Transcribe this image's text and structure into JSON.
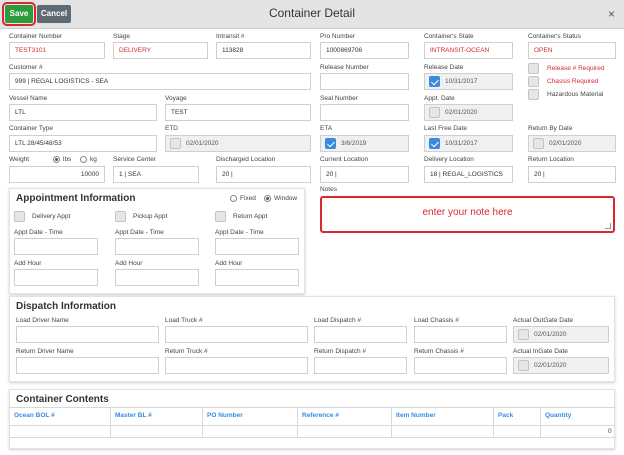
{
  "toolbar": {
    "save_label": "Save",
    "cancel_label": "Cancel",
    "title": "Container Detail",
    "close_label": "×"
  },
  "fields": {
    "container_number": {
      "label": "Container Number",
      "value": "TEST3101"
    },
    "stage": {
      "label": "Stage",
      "value": "DELIVERY"
    },
    "intransit": {
      "label": "Intransit #",
      "value": "113828"
    },
    "pro_number": {
      "label": "Pro Number",
      "value": "1000869706"
    },
    "container_state": {
      "label": "Container's State",
      "value": "INTRANSIT-OCEAN"
    },
    "container_status": {
      "label": "Container's Status",
      "value": "OPEN"
    },
    "customer": {
      "label": "Customer #",
      "value": "999 | REGAL LOGISTICS - SEA"
    },
    "release_number": {
      "label": "Release Number",
      "value": ""
    },
    "release_date": {
      "label": "Release Date",
      "value": "10/31/2017"
    },
    "vessel_name": {
      "label": "Vessel Name",
      "value": "LTL"
    },
    "voyage": {
      "label": "Voyage",
      "value": "TEST"
    },
    "seal_number": {
      "label": "Seal Number",
      "value": ""
    },
    "appt_date": {
      "label": "Appt. Date",
      "value": "02/01/2020"
    },
    "container_type": {
      "label": "Container Type",
      "value": "LTL 28/45/48/53"
    },
    "etd": {
      "label": "ETD",
      "value": "02/01/2020"
    },
    "eta": {
      "label": "ETA",
      "value": "3/6/2019"
    },
    "last_free_date": {
      "label": "Last Free Date",
      "value": "10/31/2017"
    },
    "return_by_date": {
      "label": "Return By Date",
      "value": "02/01/2020"
    },
    "weight": {
      "label": "Weight",
      "value": "10000",
      "unit_lbs": "lbs",
      "unit_kg": "kg"
    },
    "service_center": {
      "label": "Service Center",
      "value": "1 | SEA"
    },
    "discharged_location": {
      "label": "Discharged Location",
      "value": "20 |"
    },
    "current_location": {
      "label": "Current Location",
      "value": "20 |"
    },
    "delivery_location": {
      "label": "Delivery Location",
      "value": "18 | REGAL_LOGISTICS"
    },
    "return_location": {
      "label": "Return Location",
      "value": "20 |"
    }
  },
  "flags": {
    "release_required": "Release # Required",
    "chassis_required": "Chassis Required",
    "hazardous": "Hazardous Material"
  },
  "appointment": {
    "title": "Appointment Information",
    "fixed_label": "Fixed",
    "window_label": "Window",
    "delivery_appt": "Delivery Appt",
    "pickup_appt": "Pickup Appt",
    "return_appt": "Return Appt",
    "appt_date_time": "Appt Date - Time",
    "add_hour": "Add Hour"
  },
  "notes": {
    "label": "Notes",
    "placeholder": "enter your note here"
  },
  "dispatch": {
    "title": "Dispatch Information",
    "load_driver": "Load Driver Name",
    "load_truck": "Load Truck #",
    "load_dispatch": "Load Dispatch #",
    "load_chassis": "Load Chassis #",
    "actual_outgate": "Actual OutGate Date",
    "outgate_value": "02/01/2020",
    "return_driver": "Return Driver Name",
    "return_truck": "Return Truck #",
    "return_dispatch": "Return Dispatch #",
    "return_chassis": "Return Chassis #",
    "actual_ingate": "Actual InGate Date",
    "ingate_value": "02/01/2020"
  },
  "contents": {
    "title": "Container Contents",
    "columns": [
      "Ocean BOL #",
      "Master BL #",
      "PO Number",
      "Reference #",
      "Item Number",
      "Pack",
      "Quantity"
    ],
    "total_quantity": "0"
  },
  "colors": {
    "accent": "#3a8bdc",
    "save_green": "#2f9a3c",
    "alert_red": "#d9282f"
  }
}
